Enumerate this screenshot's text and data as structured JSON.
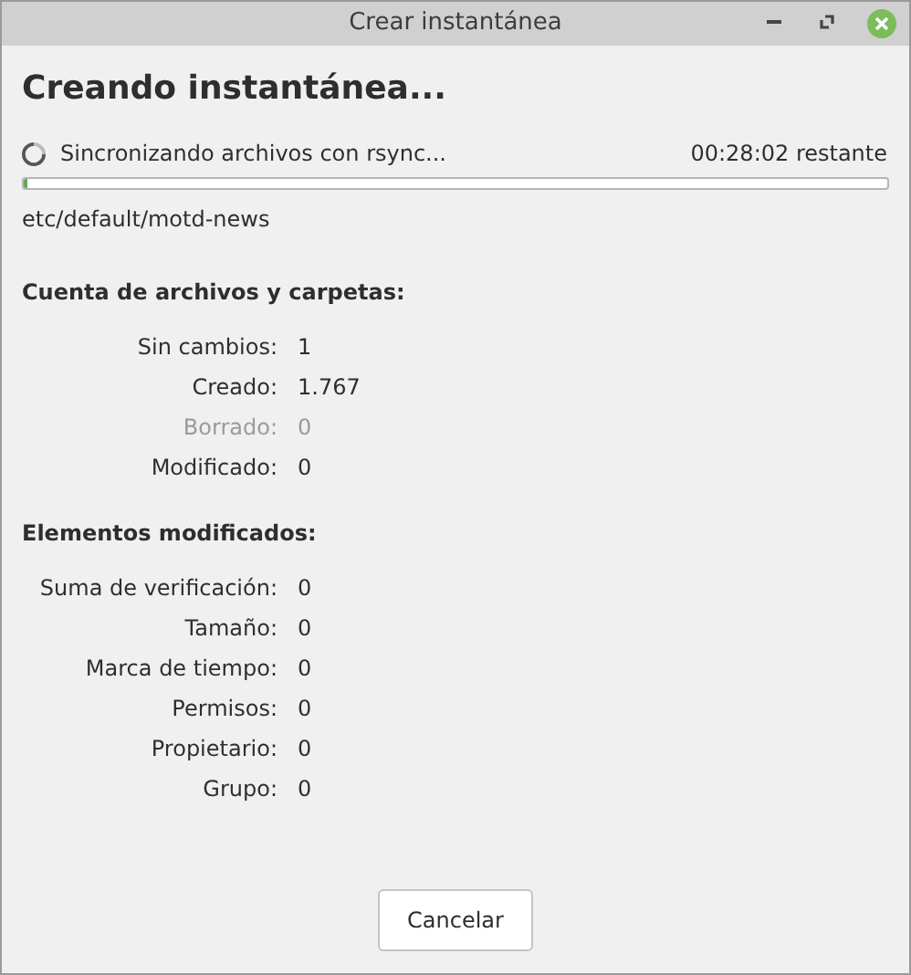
{
  "window": {
    "title": "Crear instantánea"
  },
  "heading": "Creando instantánea...",
  "status": {
    "text": "Sincronizando archivos con rsync...",
    "remaining": "00:28:02 restante"
  },
  "progress": {
    "level": 0.004
  },
  "current_file": "etc/default/motd-news",
  "sections": [
    {
      "title": "Cuenta de archivos y carpetas:",
      "rows": [
        {
          "label": "Sin cambios:",
          "value": "1",
          "disabled": false
        },
        {
          "label": "Creado:",
          "value": "1.767",
          "disabled": false
        },
        {
          "label": "Borrado:",
          "value": "0",
          "disabled": true
        },
        {
          "label": "Modificado:",
          "value": "0",
          "disabled": false
        }
      ]
    },
    {
      "title": "Elementos modificados:",
      "rows": [
        {
          "label": "Suma de verificación:",
          "value": "0",
          "disabled": false
        },
        {
          "label": "Tamaño:",
          "value": "0",
          "disabled": false
        },
        {
          "label": "Marca de tiempo:",
          "value": "0",
          "disabled": false
        },
        {
          "label": "Permisos:",
          "value": "0",
          "disabled": false
        },
        {
          "label": "Propietario:",
          "value": "0",
          "disabled": false
        },
        {
          "label": "Grupo:",
          "value": "0",
          "disabled": false
        }
      ]
    }
  ],
  "buttons": [
    "Cancelar"
  ]
}
